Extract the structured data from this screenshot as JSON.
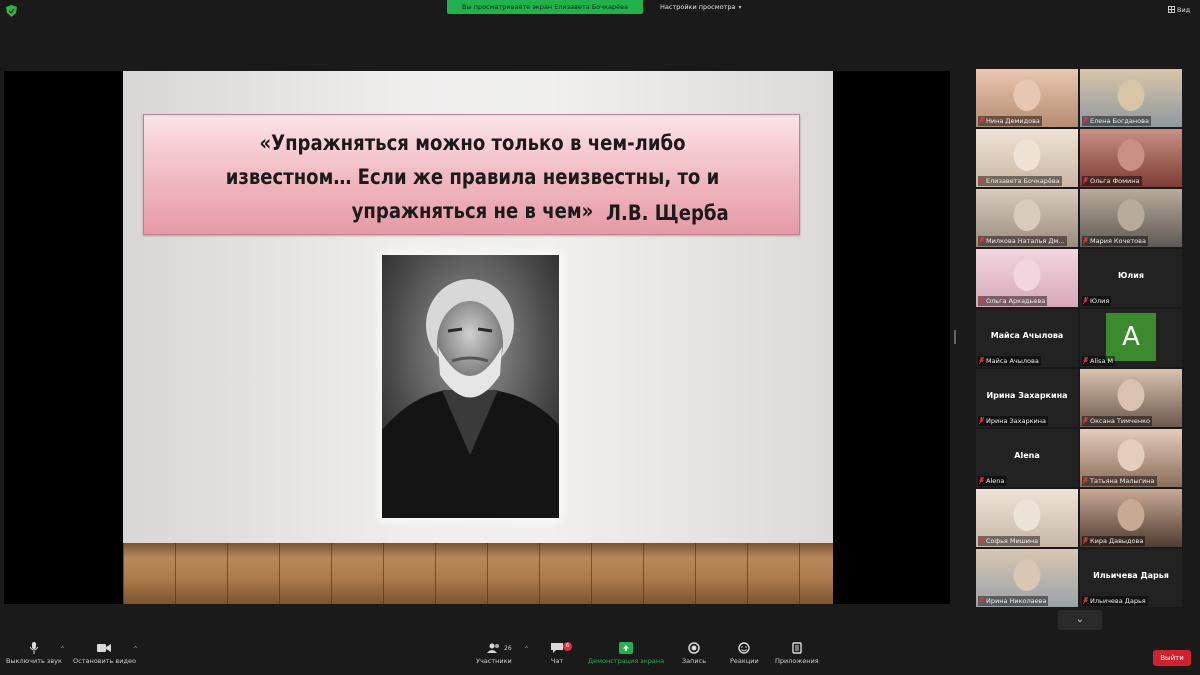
{
  "topbar": {
    "share_banner": "Вы просматриваете экран Елизавета Бочкарёва",
    "view_options": "Настройки просмотра",
    "layout_label": "Вид"
  },
  "slide": {
    "quote": "«Упражняться можно только в чем-либо известном… Если же правила неизвестны, то и упражняться не в чем»",
    "author": "Л.В. Щерба"
  },
  "gallery": {
    "tiles": [
      {
        "name": "Нина Демидова",
        "video": true
      },
      {
        "name": "Елена Богданова",
        "video": true
      },
      {
        "name": "Елизавета Бочкарёва",
        "video": true,
        "active": true
      },
      {
        "name": "Ольга Фомина",
        "video": true
      },
      {
        "name": "Милкова Наталья Дм...",
        "video": true
      },
      {
        "name": "Мария Кочетова",
        "video": true
      },
      {
        "name": "Ольга Аркадьева",
        "video": true
      },
      {
        "name": "Юлия",
        "center": "Юлия"
      },
      {
        "name": "Майса Ачылова",
        "center": "Майса Ачылова"
      },
      {
        "name": "Alisa M",
        "avatar": "A"
      },
      {
        "name": "Ирина Захаркина",
        "center": "Ирина Захаркина"
      },
      {
        "name": "Оксана Тимченко",
        "video": true
      },
      {
        "name": "Alena",
        "center": "Alena"
      },
      {
        "name": "Татьяна Малыгина",
        "video": true
      },
      {
        "name": "Софья Мишина",
        "video": true
      },
      {
        "name": "Кира Давыдова",
        "video": true
      },
      {
        "name": "Ирина Николаева",
        "video": true
      },
      {
        "name": "Ильичева Дарья",
        "center": "Ильичева Дарья"
      }
    ]
  },
  "toolbar": {
    "mute": "Выключить звук",
    "stop_video": "Остановить видео",
    "participants": "Участники",
    "participants_count": "26",
    "chat": "Чат",
    "chat_badge": "6",
    "share": "Демонстрация экрана",
    "record": "Запись",
    "reactions": "Реакции",
    "apps": "Приложения",
    "leave": "Выйти"
  },
  "colors": {
    "share_green": "#22b24c",
    "leave_red": "#d3212b",
    "active_tile": "#c8d84e"
  }
}
